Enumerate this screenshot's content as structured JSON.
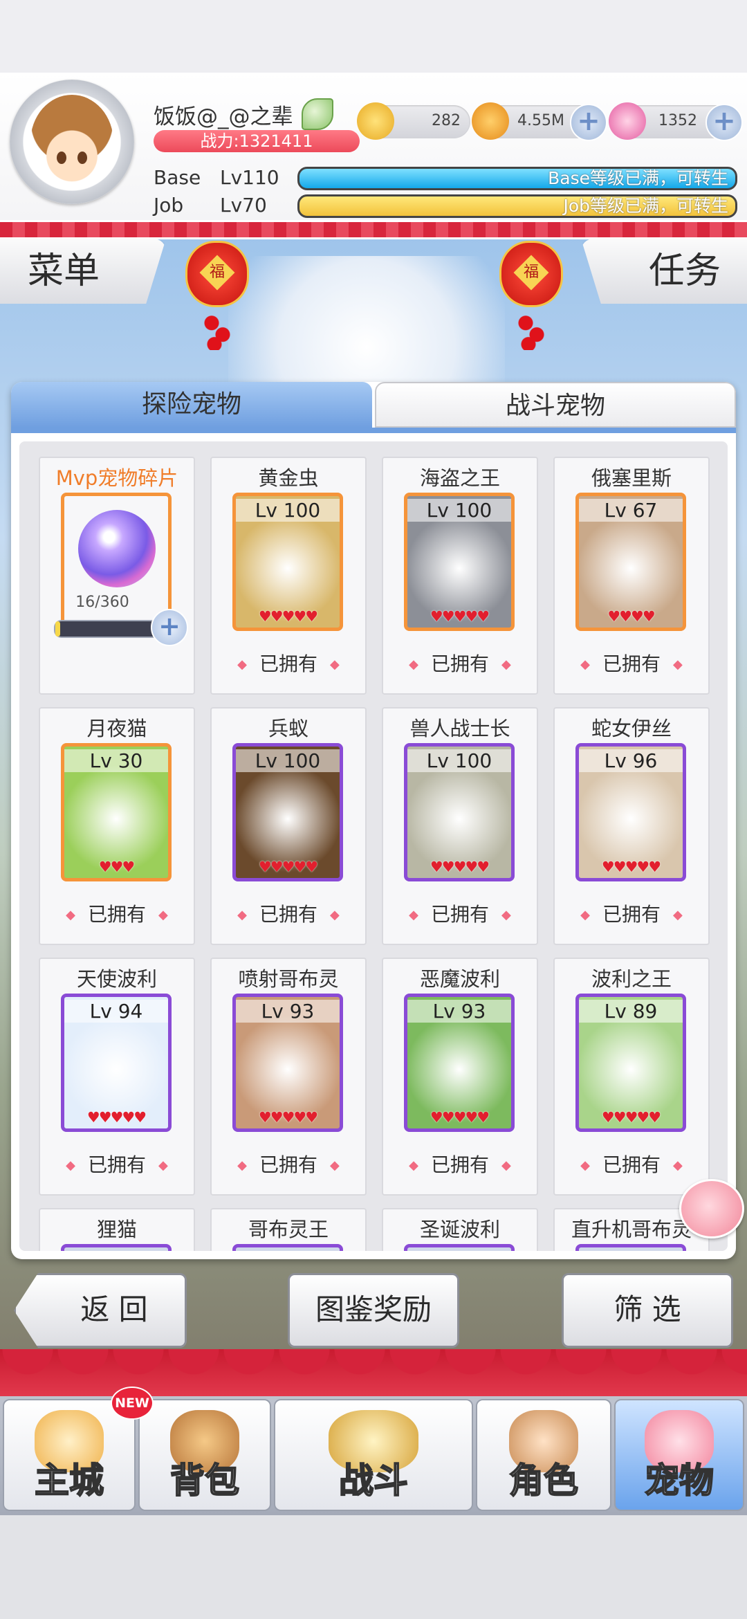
{
  "player": {
    "name": "饭饭@_@之辈",
    "power": "战力:1321411",
    "base_label": "Base",
    "base_level": "Lv110",
    "base_status": "Base等级已满，可转生",
    "job_label": "Job",
    "job_level": "Lv70",
    "job_status": "Job等级已满，可转生"
  },
  "resources": {
    "zeny": "282",
    "gold": "4.55M",
    "gem": "1352"
  },
  "side_tabs": {
    "menu": "菜单",
    "quest": "任务"
  },
  "lanterns": {
    "char": "福"
  },
  "panel_tabs": {
    "explore": "探险宠物",
    "battle": "战斗宠物"
  },
  "mvp_card": {
    "name": "Mvp宠物碎片",
    "count": "16/360",
    "progress": 0.044
  },
  "owned_label": "已拥有",
  "pets": [
    {
      "name": "黄金虫",
      "level": "Lv 100",
      "hearts": "♥♥♥♥♥",
      "frame": "orange",
      "color": "#d8b76a"
    },
    {
      "name": "海盗之王",
      "level": "Lv 100",
      "hearts": "♥♥♥♥♥",
      "frame": "orange",
      "color": "#8c8f97"
    },
    {
      "name": "俄塞里斯",
      "level": "Lv 67",
      "hearts": "♥♥♥♥",
      "frame": "orange",
      "color": "#c9a98a"
    },
    {
      "name": "月夜猫",
      "level": "Lv 30",
      "hearts": "♥♥♥",
      "frame": "orange",
      "color": "#9bcf5a"
    },
    {
      "name": "兵蚁",
      "level": "Lv 100",
      "hearts": "♥♥♥♥♥",
      "frame": "purple",
      "color": "#6b4a2c"
    },
    {
      "name": "兽人战士长",
      "level": "Lv 100",
      "hearts": "♥♥♥♥♥",
      "frame": "purple",
      "color": "#b8b7a4"
    },
    {
      "name": "蛇女伊丝",
      "level": "Lv 96",
      "hearts": "♥♥♥♥♥",
      "frame": "purple",
      "color": "#d9c6ad"
    },
    {
      "name": "天使波利",
      "level": "Lv 94",
      "hearts": "♥♥♥♥♥",
      "frame": "purple",
      "color": "#e3eefb"
    },
    {
      "name": "喷射哥布灵",
      "level": "Lv 93",
      "hearts": "♥♥♥♥♥",
      "frame": "purple",
      "color": "#c99a78"
    },
    {
      "name": "恶魔波利",
      "level": "Lv 93",
      "hearts": "♥♥♥♥♥",
      "frame": "purple",
      "color": "#7dba5e"
    },
    {
      "name": "波利之王",
      "level": "Lv 89",
      "hearts": "♥♥♥♥♥",
      "frame": "purple",
      "color": "#a9d48a"
    },
    {
      "name": "狸猫",
      "level": "",
      "hearts": "",
      "frame": "purple",
      "color": "#d0d8ea"
    },
    {
      "name": "哥布灵王",
      "level": "",
      "hearts": "",
      "frame": "purple",
      "color": "#d0d8ea"
    },
    {
      "name": "圣诞波利",
      "level": "",
      "hearts": "",
      "frame": "purple",
      "color": "#d0d8ea"
    },
    {
      "name": "直升机哥布灵",
      "level": "",
      "hearts": "",
      "frame": "purple",
      "color": "#d0d8ea"
    }
  ],
  "bottom_buttons": {
    "back": "返 回",
    "reward": "图鉴奖励",
    "filter": "筛 选"
  },
  "nav": {
    "new_badge": "NEW",
    "items": [
      "主城",
      "背包",
      "战斗",
      "角色",
      "宠物"
    ]
  },
  "colors": {
    "accent_blue": "#6f9fe0",
    "power_red": "#ec4a5a",
    "frame_orange": "#f5943a",
    "frame_purple": "#8a4bd6"
  }
}
